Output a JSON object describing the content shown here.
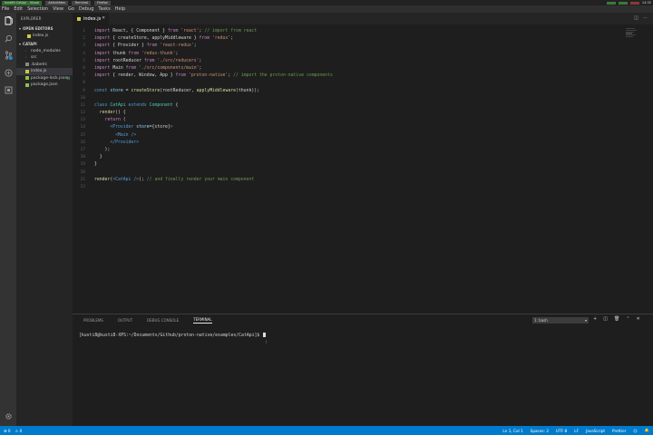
{
  "system_bar": {
    "windows": [
      "kustiBi CatApi - Visual",
      "Aktivitäten",
      "Terminal",
      "Firefox"
    ],
    "clock": "14:32"
  },
  "menu": [
    "File",
    "Edit",
    "Selection",
    "View",
    "Go",
    "Debug",
    "Tasks",
    "Help"
  ],
  "sidebar": {
    "title": "EXPLORER",
    "open_editors_label": "OPEN EDITORS",
    "open_editor_file": "index.js",
    "folder_label": "CATAPI",
    "items": [
      {
        "label": "node_modules",
        "type": "folder"
      },
      {
        "label": "src",
        "type": "folder"
      },
      {
        "label": ".babelrc",
        "type": "file"
      },
      {
        "label": "index.js",
        "type": "file",
        "selected": true
      },
      {
        "label": "package-lock.json",
        "type": "file",
        "badge": "M"
      },
      {
        "label": "package.json",
        "type": "file"
      }
    ]
  },
  "tab": {
    "label": "index.js"
  },
  "editor": {
    "lines": [
      [
        [
          "kw",
          "import"
        ],
        [
          "pn",
          " React, { Component } "
        ],
        [
          "kw",
          "from"
        ],
        [
          "st",
          " 'react'"
        ],
        [
          "pn",
          ";"
        ],
        [
          "cm",
          " // import from react"
        ]
      ],
      [
        [
          "kw",
          "import"
        ],
        [
          "pn",
          " { createStore, applyMiddleware } "
        ],
        [
          "kw",
          "from"
        ],
        [
          "st",
          " 'redux'"
        ],
        [
          "pn",
          ";"
        ]
      ],
      [
        [
          "kw",
          "import"
        ],
        [
          "pn",
          " { Provider } "
        ],
        [
          "kw",
          "from"
        ],
        [
          "st",
          " 'react-redux'"
        ],
        [
          "pn",
          ";"
        ]
      ],
      [
        [
          "kw",
          "import"
        ],
        [
          "pn",
          " thunk "
        ],
        [
          "kw",
          "from"
        ],
        [
          "st",
          " 'redux-thunk'"
        ],
        [
          "pn",
          ";"
        ]
      ],
      [
        [
          "kw",
          "import"
        ],
        [
          "pn",
          " rootReducer "
        ],
        [
          "kw",
          "from"
        ],
        [
          "st",
          " './src/reducers'"
        ],
        [
          "pn",
          ";"
        ]
      ],
      [
        [
          "kw",
          "import"
        ],
        [
          "pn",
          " Main "
        ],
        [
          "kw",
          "from"
        ],
        [
          "st",
          " './src/components/main'"
        ],
        [
          "pn",
          ";"
        ]
      ],
      [
        [
          "kw",
          "import"
        ],
        [
          "pn",
          " { render, Window, App } "
        ],
        [
          "kw",
          "from"
        ],
        [
          "st",
          " 'proton-native'"
        ],
        [
          "pn",
          ";"
        ],
        [
          "cm",
          " // import the proton-native components"
        ]
      ],
      [],
      [
        [
          "kb",
          "const"
        ],
        [
          "vr",
          " store"
        ],
        [
          "pn",
          " = "
        ],
        [
          "fn",
          "createStore"
        ],
        [
          "pn",
          "(rootReducer, "
        ],
        [
          "fn",
          "applyMiddleware"
        ],
        [
          "pn",
          "(thunk));"
        ]
      ],
      [],
      [
        [
          "kb",
          "class"
        ],
        [
          "cl",
          " CatApi"
        ],
        [
          "kb",
          " extends"
        ],
        [
          "cl",
          " Component"
        ],
        [
          "pn",
          " {"
        ]
      ],
      [
        [
          "pn",
          "  "
        ],
        [
          "fn",
          "render"
        ],
        [
          "pn",
          "() {"
        ]
      ],
      [
        [
          "pn",
          "    "
        ],
        [
          "kw",
          "return"
        ],
        [
          "pn",
          " ("
        ]
      ],
      [
        [
          "pn",
          "      "
        ],
        [
          "tg",
          "<Provider"
        ],
        [
          "vr",
          " store"
        ],
        [
          "pn",
          "={store}"
        ],
        [
          "tg",
          ">"
        ]
      ],
      [
        [
          "pn",
          "        "
        ],
        [
          "tg",
          "<Main"
        ],
        [
          "tg",
          " />"
        ]
      ],
      [
        [
          "pn",
          "      "
        ],
        [
          "tg",
          "</Provider>"
        ]
      ],
      [
        [
          "pn",
          "    );"
        ]
      ],
      [
        [
          "pn",
          "  }"
        ]
      ],
      [
        [
          "pn",
          "}"
        ]
      ],
      [],
      [
        [
          "fn",
          "render"
        ],
        [
          "pn",
          "("
        ],
        [
          "tg",
          "<CatApi"
        ],
        [
          "tg",
          " />"
        ],
        [
          "pn",
          ");"
        ],
        [
          "cm",
          " // and finally render your main component"
        ]
      ],
      []
    ]
  },
  "panel": {
    "tabs": [
      "PROBLEMS",
      "OUTPUT",
      "DEBUG CONSOLE",
      "TERMINAL"
    ],
    "active_tab": "TERMINAL",
    "terminal_select": "1: bash",
    "prompt": "[kusti8@kusti8-XPS:~/Documents/Github/proton-native/examples/CatApi]$ "
  },
  "status": {
    "left": [
      "⊗ 0",
      "⚠ 0"
    ],
    "ln_col": "Ln 1, Col 1",
    "spaces": "Spaces: 2",
    "encoding": "UTF-8",
    "eol": "LF",
    "language": "JavaScript",
    "formatter": "Prettier"
  }
}
